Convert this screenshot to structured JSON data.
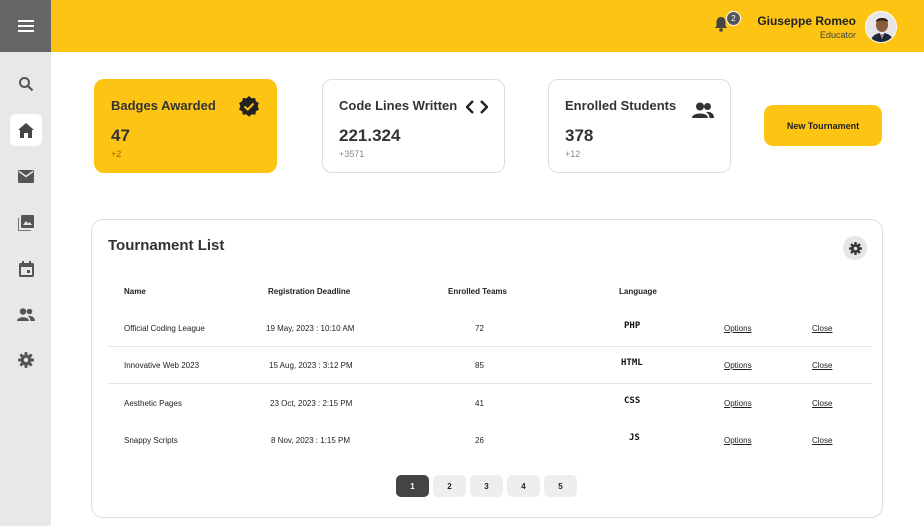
{
  "header": {
    "notification_count": "2",
    "user_name": "Giuseppe Romeo",
    "user_role": "Educator"
  },
  "sidebar": {
    "items": [
      {
        "icon": "search-icon"
      },
      {
        "icon": "home-icon",
        "active": true
      },
      {
        "icon": "mail-icon"
      },
      {
        "icon": "gallery-icon"
      },
      {
        "icon": "calendar-icon"
      },
      {
        "icon": "users-icon"
      },
      {
        "icon": "gear-icon"
      }
    ]
  },
  "cards": [
    {
      "title": "Badges Awarded",
      "value": "47",
      "sub": "+2",
      "icon": "verified-badge-icon"
    },
    {
      "title": "Code Lines Written",
      "value": "221.324",
      "sub": "+3571",
      "icon": "code-icon"
    },
    {
      "title": "Enrolled Students",
      "value": "378",
      "sub": "+12",
      "icon": "users-icon"
    }
  ],
  "new_tournament_label": "New Tournament",
  "tournament": {
    "title": "Tournament List",
    "headers": [
      "Name",
      "Registration Deadline",
      "Enrolled Teams",
      "Language"
    ],
    "rows": [
      {
        "name": "Official Coding League",
        "deadline": "19 May, 2023 : 10:10 AM",
        "teams": "72",
        "language": "PHP",
        "options": "Options",
        "close": "Close"
      },
      {
        "name": "Innovative Web 2023",
        "deadline": "15 Aug, 2023 : 3:12 PM",
        "teams": "85",
        "language": "HTML",
        "options": "Options",
        "close": "Close"
      },
      {
        "name": "Aesthetic Pages",
        "deadline": "23 Oct, 2023 : 2:15 PM",
        "teams": "41",
        "language": "CSS",
        "options": "Options",
        "close": "Close"
      },
      {
        "name": "Snappy Scripts",
        "deadline": "8 Nov, 2023 : 1:15 PM",
        "teams": "26",
        "language": "JS",
        "options": "Options",
        "close": "Close"
      }
    ],
    "pages": [
      "1",
      "2",
      "3",
      "4",
      "5"
    ],
    "current_page": "1"
  },
  "colors": {
    "accent": "#fdc413",
    "sidebar": "#e8e8e8",
    "sidebar_top": "#666666"
  }
}
